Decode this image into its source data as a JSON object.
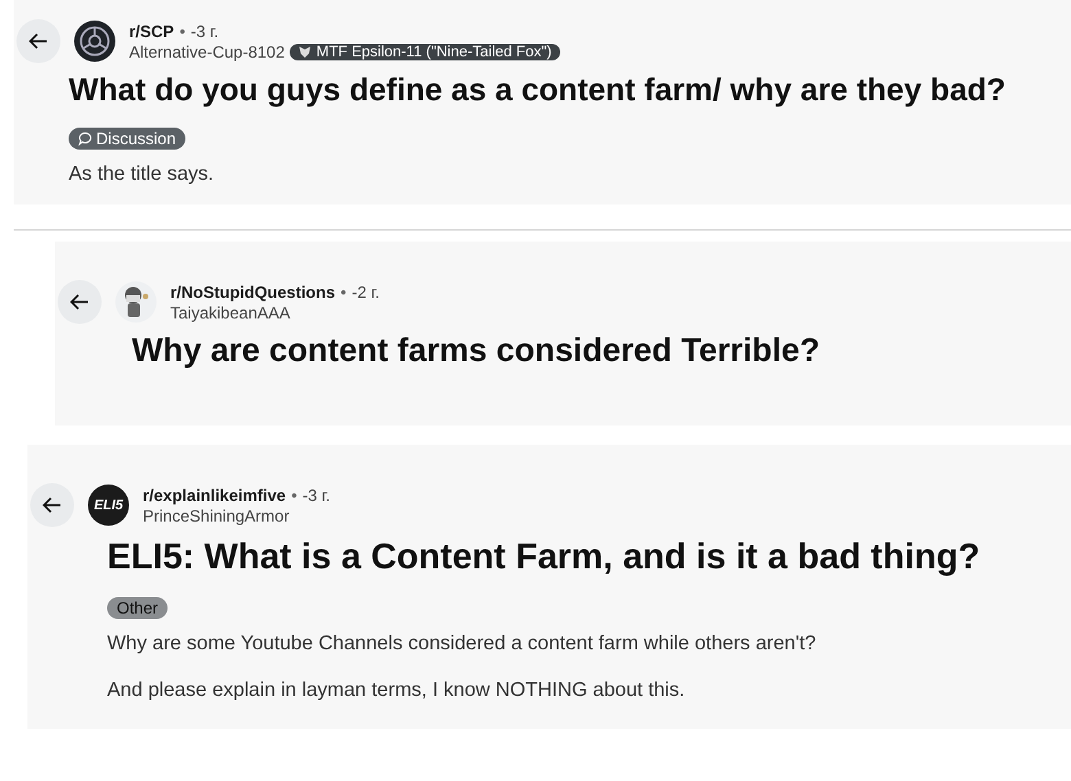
{
  "posts": [
    {
      "subreddit": "r/SCP",
      "separator": "•",
      "time": "-3 г.",
      "author": "Alternative-Cup-8102",
      "avatar": {
        "kind": "scp"
      },
      "user_flair": "MTF Epsilon-11 (\"Nine-Tailed Fox\")",
      "title": "What do you guys define as a content farm/ why are they bad?",
      "post_flair": {
        "kind": "icon",
        "label": "Discussion"
      },
      "body": [
        "As the title says."
      ]
    },
    {
      "subreddit": "r/NoStupidQuestions",
      "separator": "•",
      "time": "-2 г.",
      "author": "TaiyakibeanAAA",
      "avatar": {
        "kind": "figure"
      },
      "title": "Why are content farms considered Terrible?"
    },
    {
      "subreddit": "r/explainlikeimfive",
      "separator": "•",
      "time": "-3 г.",
      "author": "PrinceShiningArmor",
      "avatar": {
        "kind": "text",
        "text": "ELI5"
      },
      "title": "ELI5: What is a Content Farm, and is it a bad thing?",
      "post_flair": {
        "kind": "plain",
        "label": "Other"
      },
      "body": [
        "Why are some Youtube Channels considered a content farm while others aren't?",
        "And please explain in layman terms, I know NOTHING about this."
      ]
    }
  ]
}
